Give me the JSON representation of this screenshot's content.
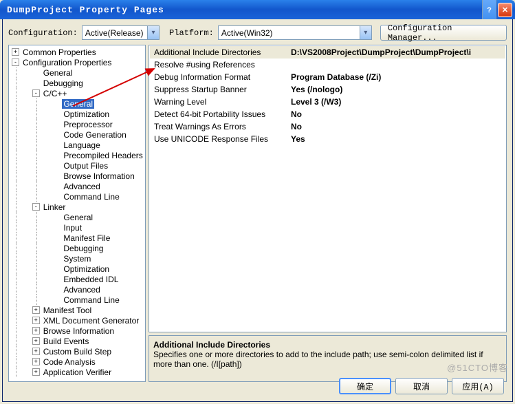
{
  "window": {
    "title": "DumpProject Property Pages"
  },
  "top": {
    "config_label": "Configuration:",
    "config_value": "Active(Release)",
    "platform_label": "Platform:",
    "platform_value": "Active(Win32)",
    "cfg_mgr_btn": "Configuration Manager..."
  },
  "tree": [
    {
      "d": 0,
      "exp": "+",
      "label": "Common Properties"
    },
    {
      "d": 0,
      "exp": "-",
      "label": "Configuration Properties"
    },
    {
      "d": 1,
      "exp": "",
      "label": "General"
    },
    {
      "d": 1,
      "exp": "",
      "label": "Debugging"
    },
    {
      "d": 1,
      "exp": "-",
      "label": "C/C++"
    },
    {
      "d": 2,
      "exp": "",
      "label": "General",
      "sel": true
    },
    {
      "d": 2,
      "exp": "",
      "label": "Optimization"
    },
    {
      "d": 2,
      "exp": "",
      "label": "Preprocessor"
    },
    {
      "d": 2,
      "exp": "",
      "label": "Code Generation"
    },
    {
      "d": 2,
      "exp": "",
      "label": "Language"
    },
    {
      "d": 2,
      "exp": "",
      "label": "Precompiled Headers"
    },
    {
      "d": 2,
      "exp": "",
      "label": "Output Files"
    },
    {
      "d": 2,
      "exp": "",
      "label": "Browse Information"
    },
    {
      "d": 2,
      "exp": "",
      "label": "Advanced"
    },
    {
      "d": 2,
      "exp": "",
      "label": "Command Line"
    },
    {
      "d": 1,
      "exp": "-",
      "label": "Linker"
    },
    {
      "d": 2,
      "exp": "",
      "label": "General"
    },
    {
      "d": 2,
      "exp": "",
      "label": "Input"
    },
    {
      "d": 2,
      "exp": "",
      "label": "Manifest File"
    },
    {
      "d": 2,
      "exp": "",
      "label": "Debugging"
    },
    {
      "d": 2,
      "exp": "",
      "label": "System"
    },
    {
      "d": 2,
      "exp": "",
      "label": "Optimization"
    },
    {
      "d": 2,
      "exp": "",
      "label": "Embedded IDL"
    },
    {
      "d": 2,
      "exp": "",
      "label": "Advanced"
    },
    {
      "d": 2,
      "exp": "",
      "label": "Command Line"
    },
    {
      "d": 1,
      "exp": "+",
      "label": "Manifest Tool"
    },
    {
      "d": 1,
      "exp": "+",
      "label": "XML Document Generator"
    },
    {
      "d": 1,
      "exp": "+",
      "label": "Browse Information"
    },
    {
      "d": 1,
      "exp": "+",
      "label": "Build Events"
    },
    {
      "d": 1,
      "exp": "+",
      "label": "Custom Build Step"
    },
    {
      "d": 1,
      "exp": "+",
      "label": "Code Analysis"
    },
    {
      "d": 1,
      "exp": "+",
      "label": "Application Verifier"
    }
  ],
  "grid": [
    {
      "name": "Additional Include Directories",
      "val": "D:\\VS2008Project\\DumpProject\\DumpProject\\i",
      "sel": true
    },
    {
      "name": "Resolve #using References",
      "val": ""
    },
    {
      "name": "Debug Information Format",
      "val": "Program Database (/Zi)"
    },
    {
      "name": "Suppress Startup Banner",
      "val": "Yes (/nologo)"
    },
    {
      "name": "Warning Level",
      "val": "Level 3 (/W3)"
    },
    {
      "name": "Detect 64-bit Portability Issues",
      "val": "No"
    },
    {
      "name": "Treat Warnings As Errors",
      "val": "No"
    },
    {
      "name": "Use UNICODE Response Files",
      "val": "Yes"
    }
  ],
  "help": {
    "title": "Additional Include Directories",
    "body": "Specifies one or more directories to add to the include path; use semi-colon delimited list if more than one.     (/I[path])"
  },
  "buttons": {
    "ok": "确定",
    "cancel": "取消",
    "apply": "应用(A)"
  },
  "watermark": "@51CTO博客"
}
